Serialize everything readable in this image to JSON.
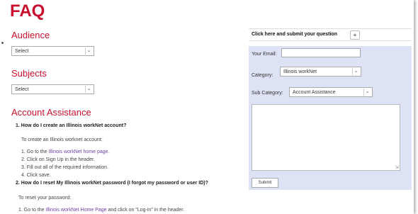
{
  "page": {
    "title": "FAQ"
  },
  "audience": {
    "heading": "Audience",
    "select_value": "Select"
  },
  "subjects": {
    "heading": "Subjects",
    "select_value": "Select"
  },
  "account": {
    "heading": "Account Assistance",
    "q1": "1. How do I create an Illinois workNet account?",
    "q1_intro": "To create an Illinois worknet account:",
    "q1_step1_pre": "1. Go to the ",
    "q1_step1_link": "Illinois workNet home page",
    "q1_step1_post": ".",
    "q1_step2": "2. Click on Sign Up in the header.",
    "q1_step3": "3. Fill out all of the required information.",
    "q1_step4": "4. Click save.",
    "q2": "2. How do I reset My Illinois workNet password (I forgot my password or user ID)?",
    "q2_intro": "To reset your password:",
    "q2_step1_pre": "1. Go to the ",
    "q2_step1_link": "Illinois workNet Home Page",
    "q2_step1_post": " and click on \"Log-in\" in the header."
  },
  "question_form": {
    "header_label": "Click here and submit your question",
    "plus_label": "+",
    "email_label": "Your Email:",
    "email_value": "",
    "category_label": "Category:",
    "category_value": "Illinois workNet",
    "subcategory_label": "Sub Category:",
    "subcategory_value": "Account Assistance",
    "question_text": "",
    "submit_label": "Submit"
  },
  "icons": {
    "dropdown": "chevron-down-icon",
    "resize": "resize-handle-icon"
  },
  "colors": {
    "accent": "#c8102e",
    "link": "#6b3fa0",
    "form_bg": "#dde2f4"
  }
}
